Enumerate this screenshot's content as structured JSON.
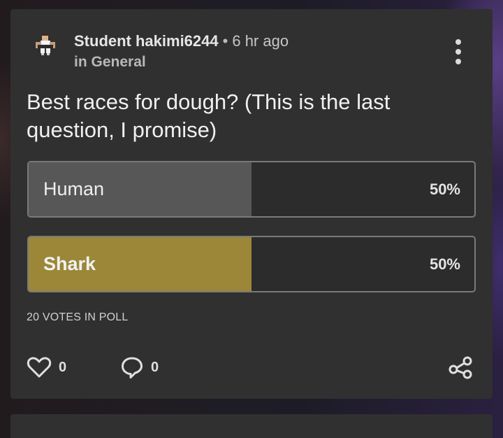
{
  "post": {
    "author": "Student hakimi6244",
    "separator": "•",
    "time": "6 hr ago",
    "category": "in General",
    "question": "Best races for dough? (This is the last question, I promise)"
  },
  "poll": {
    "options": [
      {
        "label": "Human",
        "percent_text": "50%",
        "percent": 50,
        "color": "#575757"
      },
      {
        "label": "Shark",
        "percent_text": "50%",
        "percent": 50,
        "color": "#9b8737"
      }
    ],
    "votes_text": "20 VOTES IN POLL"
  },
  "actions": {
    "like_icon": "heart-icon",
    "like_count": "0",
    "comment_icon": "comment-icon",
    "comment_count": "0",
    "share_icon": "share-icon",
    "menu_icon": "more-vertical-icon"
  }
}
